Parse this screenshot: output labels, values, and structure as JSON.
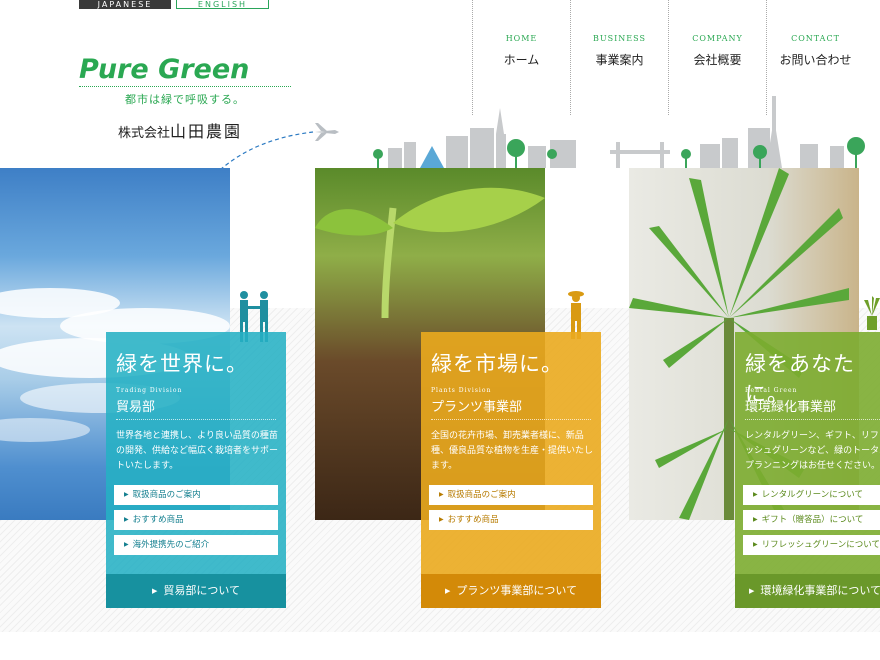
{
  "language": {
    "japanese": "JAPANESE",
    "english": "ENGLISH"
  },
  "logo": {
    "title": "Pure Green",
    "tagline": "都市は緑で呼吸する。",
    "company_prefix": "株式会社",
    "company_name": "山田農園"
  },
  "nav": [
    {
      "en": "HOME",
      "ja": "ホーム"
    },
    {
      "en": "BUSINESS",
      "ja": "事業案内"
    },
    {
      "en": "COMPANY",
      "ja": "会社概要"
    },
    {
      "en": "CONTACT",
      "ja": "お問い合わせ"
    }
  ],
  "cards": [
    {
      "title": "緑を世界に。",
      "division_en": "Trading Division",
      "division": "貿易部",
      "description": "世界各地と連携し、より良い品質の種苗の開発、供給など幅広く栽培者をサポートいたします。",
      "links": [
        "取扱商品のご案内",
        "おすすめ商品",
        "海外提携先のご紹介"
      ],
      "footer": "貿易部について"
    },
    {
      "title": "緑を市場に。",
      "division_en": "Plants Division",
      "division": "プランツ事業部",
      "description": "全国の花卉市場、卸売業者様に、新品種、優良品質な植物を生産・提供いたします。",
      "links": [
        "取扱商品のご案内",
        "おすすめ商品"
      ],
      "footer": "プランツ事業部について"
    },
    {
      "title": "緑をあなたに。",
      "division_en": "Rental Green",
      "division": "環境緑化事業部",
      "description": "レンタルグリーン、ギフト、リフレッシュグリーンなど、緑のトータルプランニングはお任せください。",
      "links": [
        "レンタルグリーンについて",
        "ギフト（贈答品）について",
        "リフレッシュグリーンについて"
      ],
      "footer": "環境緑化事業部について"
    }
  ],
  "colors": {
    "brand_green": "#2aa852",
    "trading": "#26b1c4",
    "plants": "#eaaa1e",
    "rental": "#7cac30"
  }
}
